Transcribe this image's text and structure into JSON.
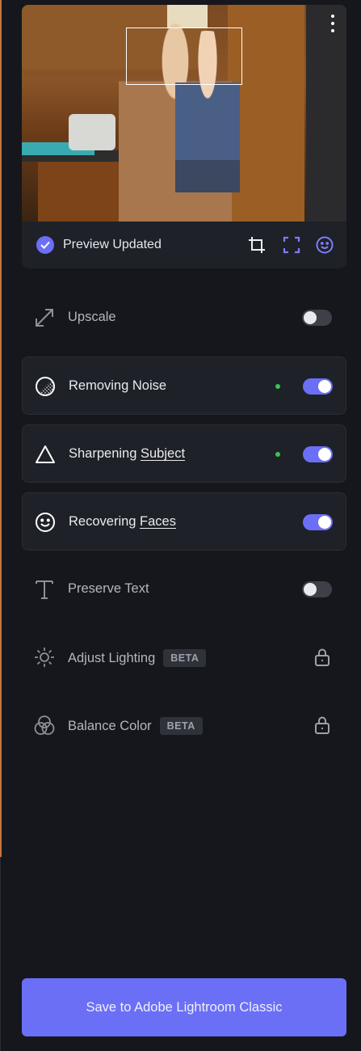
{
  "preview": {
    "status": "Preview Updated",
    "tools": [
      "crop-icon",
      "frame-icon",
      "face-icon"
    ],
    "accent": "#6b6ff5"
  },
  "enhancements": [
    {
      "label": "Upscale",
      "label_plain": "Upscale",
      "icon": "upscale-arrows-icon",
      "enabled": false,
      "active_dot": false
    },
    {
      "label_prefix": "Removing Noise",
      "icon": "noise-icon",
      "enabled": true,
      "active_dot": true
    },
    {
      "label_prefix": "Sharpening ",
      "label_ul": "Subject",
      "icon": "triangle-icon",
      "enabled": true,
      "active_dot": true
    },
    {
      "label_prefix": "Recovering ",
      "label_ul": "Faces",
      "icon": "smiley-icon",
      "enabled": true,
      "active_dot": false
    },
    {
      "label": "Preserve Text",
      "icon": "text-icon",
      "enabled": false,
      "active_dot": false
    },
    {
      "label": "Adjust Lighting",
      "badge": "BETA",
      "icon": "sun-icon",
      "locked": true
    },
    {
      "label": "Balance Color",
      "badge": "BETA",
      "icon": "color-circles-icon",
      "locked": true
    }
  ],
  "save_button": "Save to Adobe Lightroom Classic",
  "colors": {
    "toggle_on": "#6b6ff5",
    "active_dot": "#38c25a",
    "background": "#15171c"
  }
}
